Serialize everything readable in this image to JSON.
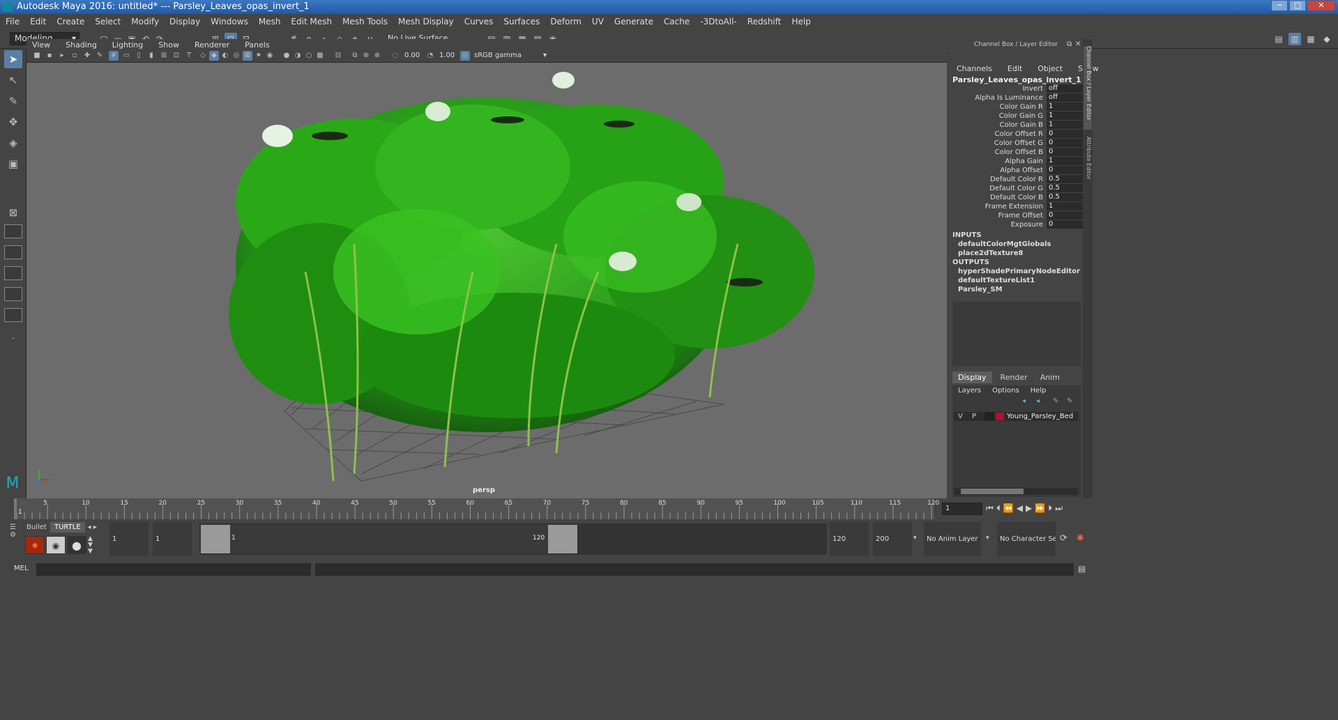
{
  "window": {
    "title": "Autodesk Maya 2016: untitled*   ---   Parsley_Leaves_opas_invert_1",
    "minimize": "─",
    "maximize": "□",
    "close": "✕"
  },
  "menubar": [
    "File",
    "Edit",
    "Create",
    "Select",
    "Modify",
    "Display",
    "Windows",
    "Mesh",
    "Edit Mesh",
    "Mesh Tools",
    "Mesh Display",
    "Curves",
    "Surfaces",
    "Deform",
    "UV",
    "Generate",
    "Cache",
    "-3DtoAll-",
    "Redshift",
    "Help"
  ],
  "statusline": {
    "mode": "Modeling",
    "live_surface": "No Live Surface"
  },
  "panel": {
    "menus": [
      "View",
      "Shading",
      "Lighting",
      "Show",
      "Renderer",
      "Panels"
    ],
    "exposure": "0.00",
    "gamma": "1.00",
    "colorspace": "sRGB gamma",
    "camera_label": "persp"
  },
  "channel_box": {
    "header": "Channel Box / Layer Editor",
    "menus": [
      "Channels",
      "Edit",
      "Object",
      "Show"
    ],
    "node_name": "Parsley_Leaves_opas_invert_1",
    "attributes": [
      {
        "name": "Invert",
        "value": "off"
      },
      {
        "name": "Alpha Is Luminance",
        "value": "off"
      },
      {
        "name": "Color Gain R",
        "value": "1"
      },
      {
        "name": "Color Gain G",
        "value": "1"
      },
      {
        "name": "Color Gain B",
        "value": "1"
      },
      {
        "name": "Color Offset R",
        "value": "0"
      },
      {
        "name": "Color Offset G",
        "value": "0"
      },
      {
        "name": "Color Offset B",
        "value": "0"
      },
      {
        "name": "Alpha Gain",
        "value": "1"
      },
      {
        "name": "Alpha Offset",
        "value": "0"
      },
      {
        "name": "Default Color R",
        "value": "0.5"
      },
      {
        "name": "Default Color G",
        "value": "0.5"
      },
      {
        "name": "Default Color B",
        "value": "0.5"
      },
      {
        "name": "Frame Extension",
        "value": "1"
      },
      {
        "name": "Frame Offset",
        "value": "0"
      },
      {
        "name": "Exposure",
        "value": "0"
      }
    ],
    "inputs_label": "INPUTS",
    "inputs": [
      "defaultColorMgtGlobals",
      "place2dTexture8"
    ],
    "outputs_label": "OUTPUTS",
    "outputs": [
      "hyperShadePrimaryNodeEditorSavedT...",
      "defaultTextureList1",
      "Parsley_SM"
    ]
  },
  "layer_editor": {
    "tabs": [
      "Display",
      "Render",
      "Anim"
    ],
    "menus": [
      "Layers",
      "Options",
      "Help"
    ],
    "layer": {
      "v": "V",
      "p": "P",
      "name": "Young_Parsley_Bed",
      "color": "#b01030"
    }
  },
  "side_tabs": [
    "Channel Box / Layer Editor",
    "Attribute Editor"
  ],
  "timeline": {
    "ticks": [
      5,
      10,
      15,
      20,
      25,
      30,
      35,
      40,
      45,
      50,
      55,
      60,
      65,
      70,
      75,
      80,
      85,
      90,
      95,
      100,
      105,
      110,
      115,
      120
    ],
    "start_label": "1",
    "current_frame": "1"
  },
  "range": {
    "shelf_tabs": [
      "Bullet",
      "TURTLE"
    ],
    "start_field": "1",
    "anim_start": "1",
    "range_start_label": "1",
    "range_end_label": "120",
    "end_field": "120",
    "anim_end": "200",
    "anim_layer": "No Anim Layer",
    "char_set": "No Character Set"
  },
  "command": {
    "lang": "MEL"
  },
  "colors": {
    "accent": "#5a7fa6",
    "viewport_bg": "#6c6c6c",
    "title_blue": "#2a66b4"
  }
}
